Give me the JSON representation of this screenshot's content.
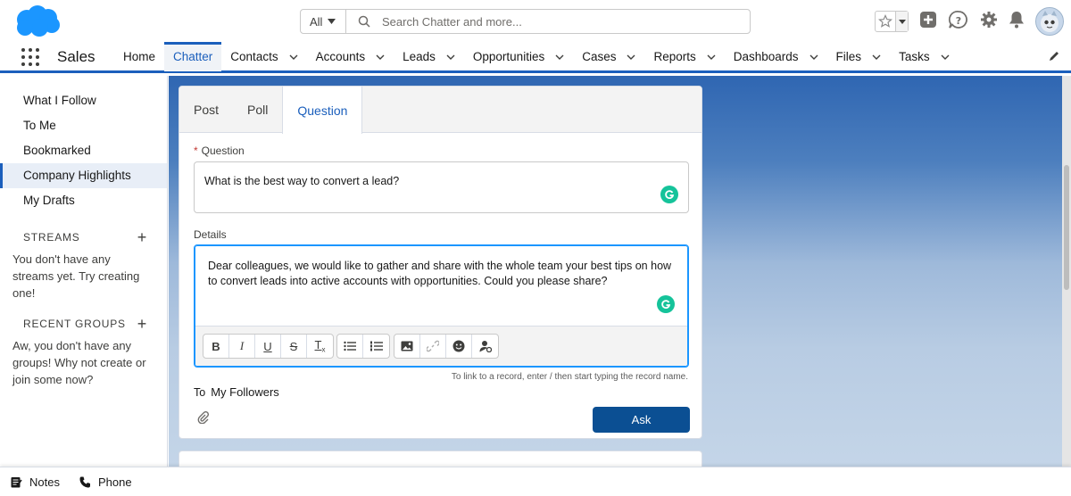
{
  "header": {
    "search_scope": "All",
    "search_placeholder": "Search Chatter and more..."
  },
  "nav": {
    "app_name": "Sales",
    "items": [
      {
        "label": "Home",
        "chevron": false
      },
      {
        "label": "Chatter",
        "chevron": false,
        "active": true
      },
      {
        "label": "Contacts",
        "chevron": true
      },
      {
        "label": "Accounts",
        "chevron": true
      },
      {
        "label": "Leads",
        "chevron": true
      },
      {
        "label": "Opportunities",
        "chevron": true
      },
      {
        "label": "Cases",
        "chevron": true
      },
      {
        "label": "Reports",
        "chevron": true
      },
      {
        "label": "Dashboards",
        "chevron": true
      },
      {
        "label": "Files",
        "chevron": true
      },
      {
        "label": "Tasks",
        "chevron": true
      }
    ]
  },
  "sidebar": {
    "links": [
      "What I Follow",
      "To Me",
      "Bookmarked",
      "Company Highlights",
      "My Drafts"
    ],
    "streams_title": "STREAMS",
    "streams_text": "You don't have any streams yet. Try creating one!",
    "groups_title": "RECENT GROUPS",
    "groups_text": "Aw, you don't have any groups! Why not create or join some now?"
  },
  "composer": {
    "tabs": [
      "Post",
      "Poll",
      "Question"
    ],
    "question_label": "Question",
    "required_mark": "*",
    "question_value": "What is the best way to convert a lead?",
    "details_label": "Details",
    "details_value": "Dear colleagues, we would like to gather and share with the whole team your best tips on how to convert leads into active accounts with opportunities. Could you please share?",
    "hint": "To link to a record, enter / then start typing the record name.",
    "to_label": "To",
    "to_value": "My Followers",
    "ask_label": "Ask"
  },
  "utility": {
    "notes": "Notes",
    "phone": "Phone"
  }
}
